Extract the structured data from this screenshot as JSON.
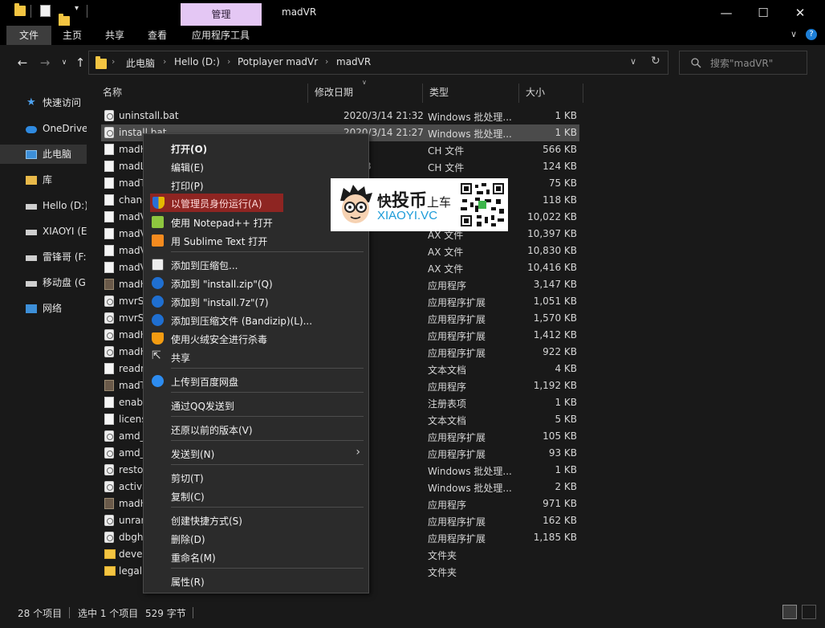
{
  "titlebar": {
    "manage_tab": "管理",
    "window_title": "madVR",
    "minimize": "—",
    "maximize": "☐",
    "close": "✕"
  },
  "ribbon": {
    "tabs": [
      "文件",
      "主页",
      "共享",
      "查看",
      "应用程序工具"
    ],
    "active_index": 0
  },
  "address": {
    "crumbs": [
      "此电脑",
      "Hello (D:)",
      "Potplayer madVr",
      "madVR"
    ],
    "search_placeholder": "搜索\"madVR\""
  },
  "nav": {
    "items": [
      "快速访问",
      "OneDrive",
      "此电脑",
      "库",
      "Hello (D:)",
      "XIAOYI (E",
      "雷锋哥 (F:",
      "移动盘 (G",
      "网络"
    ],
    "selected_index": 2
  },
  "columns": {
    "name": "名称",
    "date": "修改日期",
    "type": "类型",
    "size": "大小"
  },
  "files": [
    {
      "name": "uninstall.bat",
      "date": "2020/3/14 21:32",
      "type": "Windows 批处理...",
      "size": "1 KB",
      "icon": "gear"
    },
    {
      "name": "install.bat",
      "date": "2020/3/14 21:27",
      "type": "Windows 批处理...",
      "size": "1 KB",
      "icon": "gear"
    },
    {
      "name": "madH",
      "date": "7:23",
      "type": "CH 文件",
      "size": "566 KB",
      "icon": "doc"
    },
    {
      "name": "madL",
      "date": "23:53",
      "type": "CH 文件",
      "size": "124 KB",
      "icon": "doc"
    },
    {
      "name": "madT",
      "date": "",
      "type": "",
      "size": "75 KB",
      "icon": "doc"
    },
    {
      "name": "chang",
      "date": "",
      "type": "",
      "size": "118 KB",
      "icon": "doc"
    },
    {
      "name": "madV",
      "date": "",
      "type": "",
      "size": "10,022 KB",
      "icon": "doc"
    },
    {
      "name": "madV",
      "date": "2:46",
      "type": "AX 文件",
      "size": "10,397 KB",
      "icon": "doc"
    },
    {
      "name": "madV",
      "date": "2:45",
      "type": "AX 文件",
      "size": "10,830 KB",
      "icon": "doc"
    },
    {
      "name": "madV",
      "date": "2:44",
      "type": "AX 文件",
      "size": "10,416 KB",
      "icon": "doc"
    },
    {
      "name": "madH",
      "date": "2:37",
      "type": "应用程序",
      "size": "3,147 KB",
      "icon": "app"
    },
    {
      "name": "mvrS",
      "date": "0:14",
      "type": "应用程序扩展",
      "size": "1,051 KB",
      "icon": "gear"
    },
    {
      "name": "mvrS",
      "date": "0:14",
      "type": "应用程序扩展",
      "size": "1,570 KB",
      "icon": "gear"
    },
    {
      "name": "madH",
      "date": ":53",
      "type": "应用程序扩展",
      "size": "1,412 KB",
      "icon": "gear"
    },
    {
      "name": "madH",
      "date": ":53",
      "type": "应用程序扩展",
      "size": "922 KB",
      "icon": "gear"
    },
    {
      "name": "readr",
      "date": "6:50",
      "type": "文本文档",
      "size": "4 KB",
      "icon": "doc"
    },
    {
      "name": "madT",
      "date": "7:27",
      "type": "应用程序",
      "size": "1,192 KB",
      "icon": "app"
    },
    {
      "name": "enab",
      "date": "7:35",
      "type": "注册表项",
      "size": "1 KB",
      "icon": "doc"
    },
    {
      "name": "licens",
      "date": "5:59",
      "type": "文本文档",
      "size": "5 KB",
      "icon": "doc"
    },
    {
      "name": "amd_",
      "date": ":25",
      "type": "应用程序扩展",
      "size": "105 KB",
      "icon": "gear"
    },
    {
      "name": "amd_",
      "date": ":25",
      "type": "应用程序扩展",
      "size": "93 KB",
      "icon": "gear"
    },
    {
      "name": "resto",
      "date": ":43",
      "type": "Windows 批处理...",
      "size": "1 KB",
      "icon": "gear"
    },
    {
      "name": "activa",
      "date": "0:45",
      "type": "Windows 批处理...",
      "size": "2 KB",
      "icon": "gear"
    },
    {
      "name": "madH",
      "date": ":23",
      "type": "应用程序",
      "size": "971 KB",
      "icon": "app"
    },
    {
      "name": "unrar",
      "date": "0:31",
      "type": "应用程序扩展",
      "size": "162 KB",
      "icon": "gear"
    },
    {
      "name": "dbgh",
      "date": ":27",
      "type": "应用程序扩展",
      "size": "1,185 KB",
      "icon": "gear"
    },
    {
      "name": "deve",
      "date": "9:55",
      "type": "文件夹",
      "size": "",
      "icon": "folder"
    },
    {
      "name": "legal",
      "date": "9:55",
      "type": "文件夹",
      "size": "",
      "icon": "folder"
    }
  ],
  "selected_file_index": 1,
  "context_menu": {
    "open": "打开(O)",
    "edit": "编辑(E)",
    "print": "打印(P)",
    "run_as_admin": "以管理员身份运行(A)",
    "open_notepadpp": "使用 Notepad++ 打开",
    "open_sublime": "用 Sublime Text 打开",
    "add_archive": "添加到压缩包...",
    "add_zip": "添加到 \"install.zip\"(Q)",
    "add_7z": "添加到 \"install.7z\"(7)",
    "add_bandizip": "添加到压缩文件 (Bandizip)(L)...",
    "scan_huorong": "使用火绒安全进行杀毒",
    "share": "共享",
    "upload_baidu": "上传到百度网盘",
    "send_qq": "通过QQ发送到",
    "restore": "还原以前的版本(V)",
    "send_to": "发送到(N)",
    "cut": "剪切(T)",
    "copy": "复制(C)",
    "create_shortcut": "创建快捷方式(S)",
    "delete": "删除(D)",
    "rename": "重命名(M)",
    "properties": "属性(R)"
  },
  "watermark": {
    "line1_a": "快",
    "line1_b": "投币",
    "line1_c": "上车",
    "line2": "XIAOYI.VC"
  },
  "status": {
    "count": "28 个项目",
    "selection": "选中 1 个项目",
    "size": "529 字节"
  },
  "colors": {
    "accent_highlight": "#8e2522",
    "manage_tab": "#e4c7f4",
    "watermark_blue": "#1b9bd8"
  }
}
